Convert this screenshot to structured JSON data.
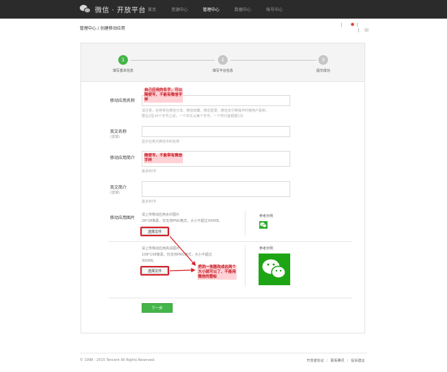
{
  "header": {
    "logo_text": "微信 · 开放平台",
    "nav": [
      "首页",
      "资源中心",
      "管理中心",
      "数据中心",
      "帐号中心"
    ],
    "active_nav_index": 2
  },
  "breadcrumb": "管理中心 / 创建移动应用",
  "steps": [
    {
      "number": "1",
      "label": "填写基本信息"
    },
    {
      "number": "2",
      "label": "填写平台信息"
    },
    {
      "number": "3",
      "label": "提交成功"
    }
  ],
  "current_step": 1,
  "form": {
    "app_name": {
      "label": "移动应用名称",
      "hint_1": "请注意，名称将在微信分享、微信收藏、微信登录、微信支付等操作时被用户看到，",
      "hint_2": "要在2至20个字节之间，一个中文占两个字节，一个符只能根据1次"
    },
    "en_name": {
      "label": "英文名称",
      "sub": "(选填)",
      "hint": "显示在英文微信中的名称"
    },
    "app_intro": {
      "label": "移动应用简介",
      "hint": "最多80字"
    },
    "en_intro": {
      "label": "英文简介",
      "sub": "(选填)",
      "hint": "最多80字"
    },
    "app_image": {
      "label": "移动应用图片",
      "small_line_1": "请上传移动应用水印图片",
      "small_line_2": "28*28像素，仅支持PNG格式，大小不超过300KB。",
      "large_line_1": "请上传移动应用高清图片",
      "large_line_2": "108*108像素，仅支持PNG格式，大小不超过",
      "large_line_3": "300KB。",
      "file_button": "选择文件",
      "ref_label": "参考示例"
    },
    "next_button": "下一步"
  },
  "annotations": {
    "name_note": [
      "自己应用的名字，可以",
      "随便写，不能有微信字",
      "样"
    ],
    "intro_note": [
      "随便写，不能带有微信",
      "字样"
    ],
    "image_note": [
      "把同一张图改成这两个",
      "大小就可以了，不能用",
      "微信的图标"
    ]
  },
  "footer": {
    "copyright": "© 1998 - 2015 Tencent All Rights Reserved.",
    "links": [
      "开发者协议",
      "联系腾讯",
      "投诉建议"
    ]
  },
  "colors": {
    "green": "#44b549",
    "annotation_red": "#d8202a",
    "topbar": "#2b2b2b"
  }
}
